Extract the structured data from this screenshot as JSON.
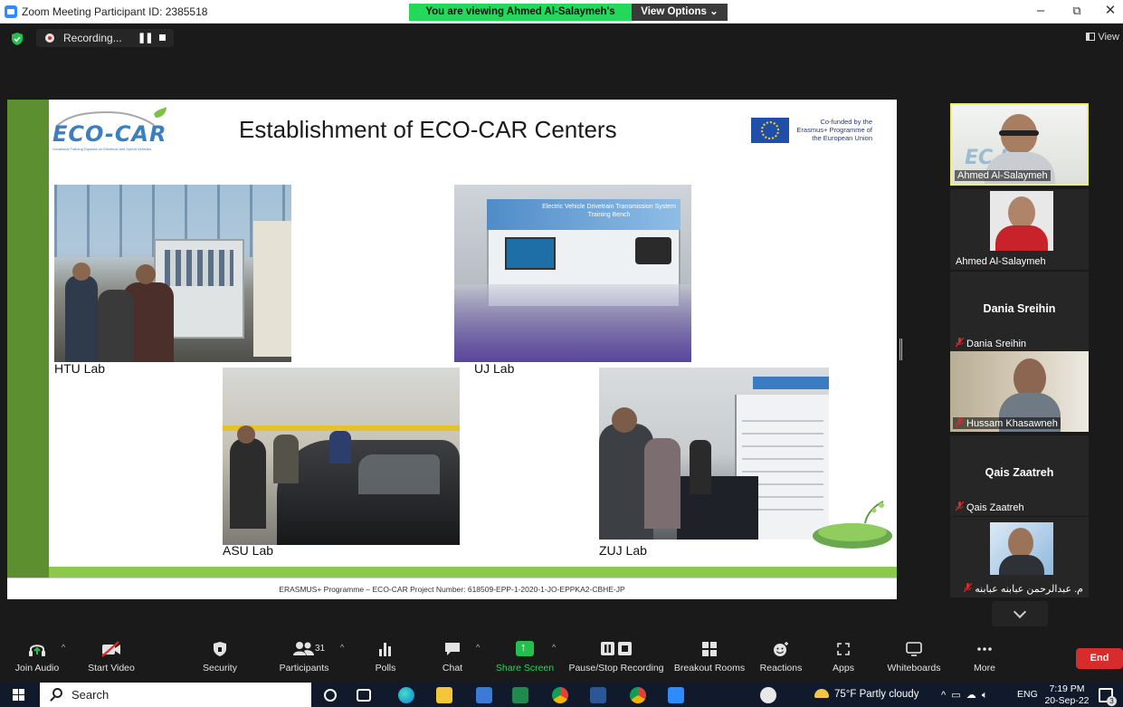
{
  "window": {
    "title": "Zoom Meeting Participant ID: 2385518",
    "minimize": "–",
    "restore": "⧉",
    "close": "✕"
  },
  "share_banner": {
    "text": "You are viewing Ahmed Al-Salaymeh's screen",
    "view_options": "View Options ⌄"
  },
  "recording": {
    "status": "Recording...",
    "pause": "❚❚"
  },
  "view_button": "View",
  "slide": {
    "title": "Establishment of ECO-CAR Centers",
    "logo_word": "ECO-CAR",
    "logo_sub": "Vocational Training Diploma on Electrical and Hybrid Vehicles",
    "eu_text": "Co-funded by the Erasmus+ Programme of the European Union",
    "labs": [
      "HTU Lab",
      "UJ Lab",
      "ASU Lab",
      "ZUJ Lab"
    ],
    "footer": "ERASMUS+ Programme – ECO-CAR Project Number: 618509-EPP-1-2020-1-JO-EPPKA2-CBHE-JP",
    "uj_poster_title": "Electric Vehicle Drivetrain Transmission System Training Bench"
  },
  "participants": [
    {
      "name": "Ahmed Al-Salaymeh",
      "type": "video",
      "active": true
    },
    {
      "name": "Ahmed Al-Salaymeh",
      "type": "photo"
    },
    {
      "name": "Dania Sreihin",
      "label": "Dania Sreihin",
      "type": "name",
      "muted": true
    },
    {
      "name": "Hussam Khasawneh",
      "type": "video",
      "muted": true
    },
    {
      "name": "Qais Zaatreh",
      "label": "Qais Zaatreh",
      "type": "name",
      "muted": true
    },
    {
      "name": "م. عبدالرحمن عبابنه عبابنه",
      "type": "video",
      "muted": true
    }
  ],
  "toolbar": {
    "join_audio": "Join Audio",
    "start_video": "Start Video",
    "security": "Security",
    "participants": "Participants",
    "participants_count": "31",
    "polls": "Polls",
    "chat": "Chat",
    "share_screen": "Share Screen",
    "pause_recording": "Pause/Stop Recording",
    "breakout_rooms": "Breakout Rooms",
    "reactions": "Reactions",
    "apps": "Apps",
    "whiteboards": "Whiteboards",
    "more": "More",
    "end": "End"
  },
  "taskbar": {
    "search": "Search",
    "weather": "75°F  Partly cloudy",
    "lang": "ENG",
    "time": "7:19 PM",
    "date": "20-Sep-22",
    "notif_count": "3"
  },
  "colors": {
    "zoom_blue": "#2d8cff",
    "share_green": "#23d959",
    "end_red": "#d82b2b",
    "slide_green": "#5c8f2f",
    "active_border": "#f0f067"
  }
}
